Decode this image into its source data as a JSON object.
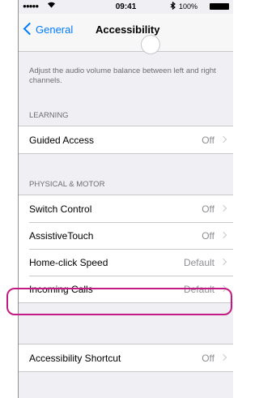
{
  "status_bar": {
    "signal": "●●●●●",
    "wifi_icon": "wifi-icon",
    "time": "09:41",
    "bluetooth_icon": "bluetooth-icon",
    "battery_percent": "100%",
    "battery_icon": "battery-icon"
  },
  "nav": {
    "back_label": "General",
    "title": "Accessibility"
  },
  "audio_balance": {
    "description": "Adjust the audio volume balance between left and right channels."
  },
  "sections": {
    "learning": {
      "header": "LEARNING",
      "items": [
        {
          "label": "Guided Access",
          "value": "Off"
        }
      ]
    },
    "physical_motor": {
      "header": "PHYSICAL & MOTOR",
      "items": [
        {
          "label": "Switch Control",
          "value": "Off"
        },
        {
          "label": "AssistiveTouch",
          "value": "Off"
        },
        {
          "label": "Home-click Speed",
          "value": "Default"
        },
        {
          "label": "Incoming Calls",
          "value": "Default"
        }
      ]
    },
    "shortcut": {
      "items": [
        {
          "label": "Accessibility Shortcut",
          "value": "Off"
        }
      ]
    }
  },
  "highlight_color": "#c41a85"
}
